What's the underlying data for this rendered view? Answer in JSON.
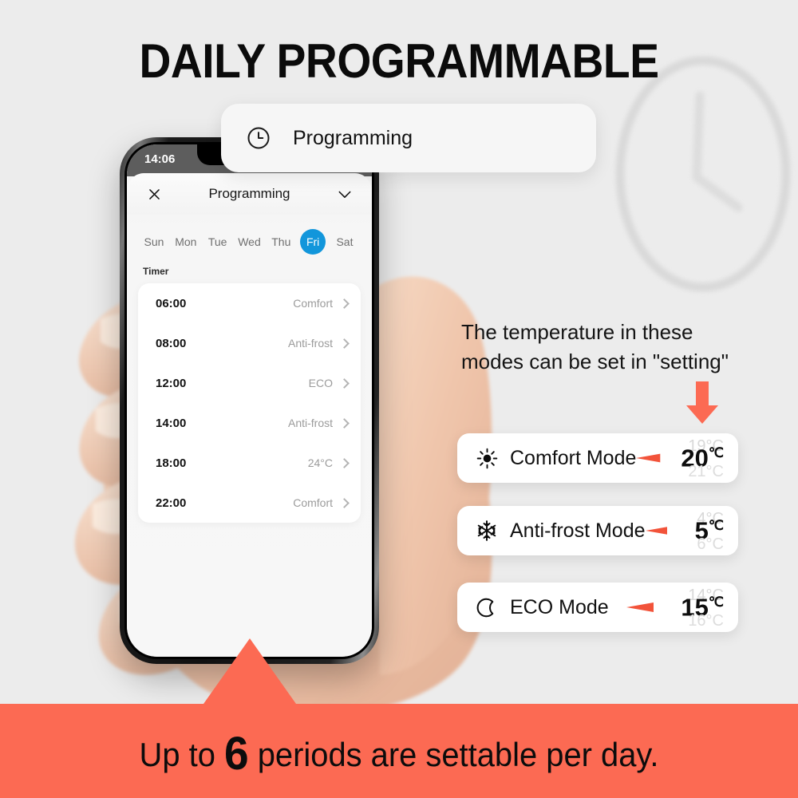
{
  "page": {
    "title": "DAILY PROGRAMMABLE",
    "background_color": "#ececec",
    "accent_color": "#fc6a53",
    "highlight_color": "#1296db"
  },
  "callout_card": {
    "icon": "clock-icon",
    "label": "Programming"
  },
  "phone": {
    "status_bar": {
      "time": "14:06"
    },
    "sheet_header": {
      "close_icon": "close-icon",
      "title": "Programming",
      "confirm_icon": "check-icon"
    },
    "day_selector": {
      "days": [
        {
          "label": "Sun",
          "active": false
        },
        {
          "label": "Mon",
          "active": false
        },
        {
          "label": "Tue",
          "active": false
        },
        {
          "label": "Wed",
          "active": false
        },
        {
          "label": "Thu",
          "active": false
        },
        {
          "label": "Fri",
          "active": true
        },
        {
          "label": "Sat",
          "active": false
        }
      ]
    },
    "timer_section": {
      "label": "Timer",
      "rows": [
        {
          "time": "06:00",
          "mode": "Comfort"
        },
        {
          "time": "08:00",
          "mode": "Anti-frost"
        },
        {
          "time": "12:00",
          "mode": "ECO"
        },
        {
          "time": "14:00",
          "mode": "Anti-frost"
        },
        {
          "time": "18:00",
          "mode": "24°C"
        },
        {
          "time": "22:00",
          "mode": "Comfort"
        }
      ]
    }
  },
  "note": {
    "line1": "The temperature in these",
    "line2": "modes can be set in \"setting\""
  },
  "modes": [
    {
      "icon": "sun-icon",
      "name": "Comfort Mode",
      "prev_value": "19°C",
      "value": "20",
      "unit": "℃",
      "next_value": "21°C"
    },
    {
      "icon": "snowflake-icon",
      "name": "Anti-frost Mode",
      "prev_value": "4°C",
      "value": "5",
      "unit": "℃",
      "next_value": "6°C"
    },
    {
      "icon": "moon-icon",
      "name": "ECO Mode",
      "prev_value": "14°C",
      "value": "15",
      "unit": "℃",
      "next_value": "16°C"
    }
  ],
  "banner": {
    "prefix": "Up to ",
    "count": "6",
    "suffix": " periods are settable per day."
  }
}
